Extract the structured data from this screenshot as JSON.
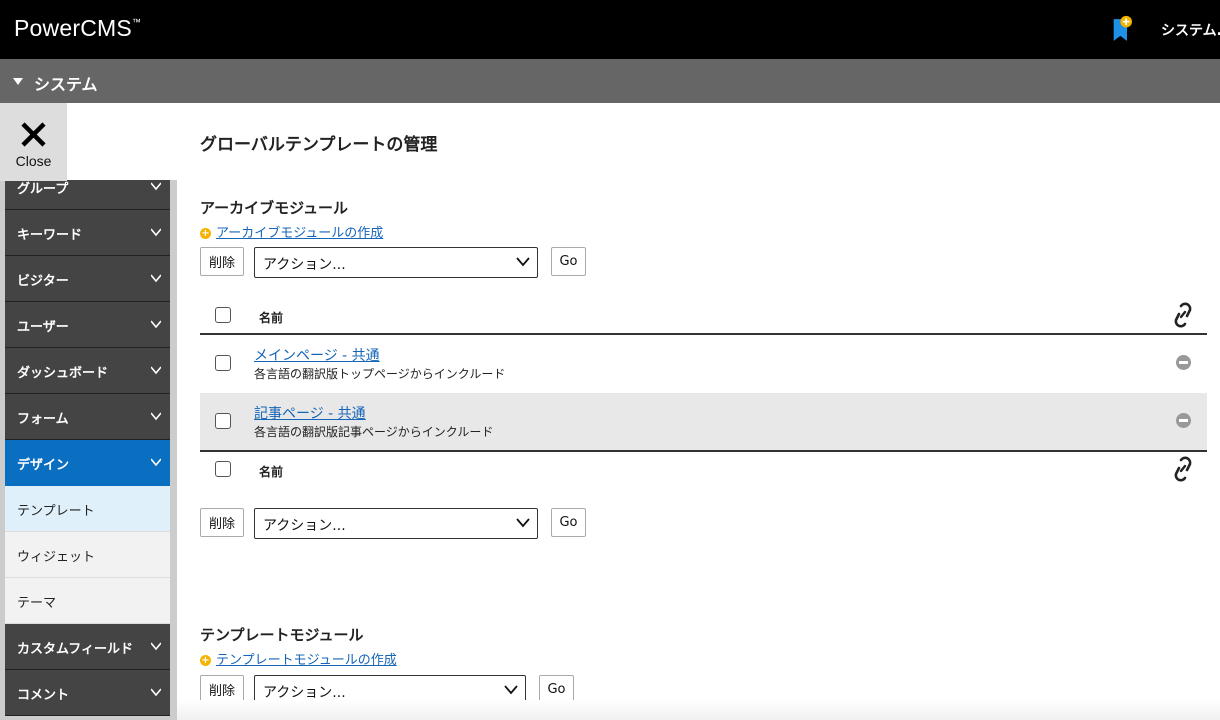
{
  "header": {
    "logo": "PowerCMS",
    "logo_tm": "™",
    "user_label": "システム..."
  },
  "system_bar": {
    "title": "システム"
  },
  "close_button": {
    "label": "Close"
  },
  "sidebar": {
    "items": [
      {
        "label": "グループ"
      },
      {
        "label": "キーワード"
      },
      {
        "label": "ビジター"
      },
      {
        "label": "ユーザー"
      },
      {
        "label": "ダッシュボード"
      },
      {
        "label": "フォーム"
      },
      {
        "label": "デザイン"
      },
      {
        "label": "カスタムフィールド"
      },
      {
        "label": "コメント"
      }
    ],
    "design_sub": [
      {
        "label": "テンプレート"
      },
      {
        "label": "ウィジェット"
      },
      {
        "label": "テーマ"
      }
    ]
  },
  "main": {
    "page_title": "グローバルテンプレートの管理",
    "archive": {
      "title": "アーカイブモジュール",
      "create_link": "アーカイブモジュールの作成",
      "delete_label": "削除",
      "action_value": "アクション...",
      "go_label": "Go",
      "col_name": "名前",
      "rows": [
        {
          "name": "メインページ - 共通",
          "desc": "各言語の翻訳版トップページからインクルード"
        },
        {
          "name": "記事ページ - 共通",
          "desc": "各言語の翻訳版記事ページからインクルード"
        }
      ]
    },
    "template": {
      "title": "テンプレートモジュール",
      "create_link": "テンプレートモジュールの作成",
      "delete_label": "削除",
      "action_value": "アクション...",
      "go_label": "Go"
    }
  },
  "colors": {
    "topbar": "#000000",
    "system_bar": "#666666",
    "active_menu": "#0b6fc1",
    "link": "#1565b8",
    "bookmark": "#1e90e6",
    "bookmark_badge": "#f5b301"
  }
}
